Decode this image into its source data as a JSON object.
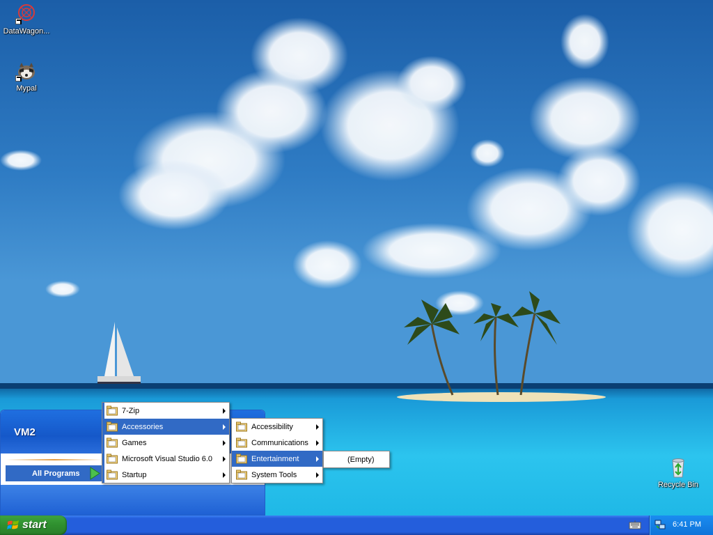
{
  "desktop": {
    "icons": [
      {
        "label": "DataWagon..."
      },
      {
        "label": "Mypal"
      },
      {
        "label": "Recycle Bin"
      }
    ]
  },
  "start_menu": {
    "user_name": "VM2",
    "all_programs_label": "All Programs"
  },
  "programs_menu": {
    "items": [
      {
        "label": "7-Zip"
      },
      {
        "label": "Accessories"
      },
      {
        "label": "Games"
      },
      {
        "label": "Microsoft Visual Studio 6.0"
      },
      {
        "label": "Startup"
      }
    ],
    "selected": "Accessories"
  },
  "accessories_menu": {
    "items": [
      {
        "label": "Accessibility"
      },
      {
        "label": "Communications"
      },
      {
        "label": "Entertainment"
      },
      {
        "label": "System Tools"
      }
    ],
    "selected": "Entertainment"
  },
  "entertainment_menu": {
    "items": [
      {
        "label": "(Empty)"
      }
    ]
  },
  "taskbar": {
    "start_label": "start",
    "clock": "6:41 PM"
  },
  "colors": {
    "menu_highlight": "#316ac5",
    "taskbar_blue": "#245edc",
    "start_green": "#3ea33e"
  }
}
